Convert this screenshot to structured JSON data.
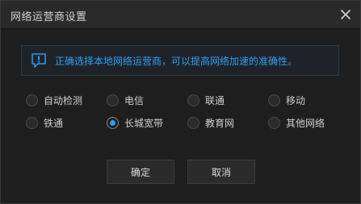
{
  "window": {
    "title": "网络运营商设置"
  },
  "notice": {
    "icon": "info-icon",
    "text": "正确选择本地网络运营商，可以提高网络加速的准确性。",
    "color": "#2e9ef0"
  },
  "options": [
    {
      "label": "自动检测",
      "selected": false
    },
    {
      "label": "电信",
      "selected": false
    },
    {
      "label": "联通",
      "selected": false
    },
    {
      "label": "移动",
      "selected": false
    },
    {
      "label": "铁通",
      "selected": false
    },
    {
      "label": "长城宽带",
      "selected": true
    },
    {
      "label": "教育网",
      "selected": false
    },
    {
      "label": "其他网络",
      "selected": false
    }
  ],
  "buttons": {
    "confirm_label": "确定",
    "cancel_label": "取消"
  },
  "colors": {
    "accent": "#2e9ef0",
    "background": "#1e1e1e",
    "titlebar": "#2a2a2a"
  }
}
